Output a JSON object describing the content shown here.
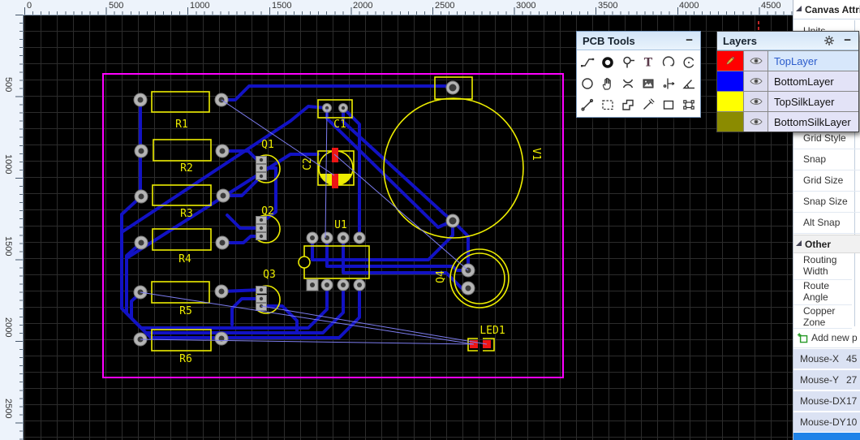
{
  "canvas": {
    "rulers": {
      "top": [
        "0",
        "500",
        "1000",
        "1500",
        "2000",
        "2500",
        "3000",
        "3500",
        "4000",
        "4500"
      ],
      "left": [
        "500",
        "1000",
        "1500",
        "2000",
        "2500"
      ]
    }
  },
  "pcb_tools": {
    "title": "PCB Tools",
    "minimize": "−",
    "tools": [
      "track",
      "pad",
      "via",
      "text",
      "arc",
      "arc-center",
      "circle",
      "drag",
      "hole",
      "image",
      "dimension",
      "angle",
      "measure",
      "select",
      "copper-area",
      "test-point",
      "rect",
      "group"
    ]
  },
  "layers": {
    "title": "Layers",
    "minimize": "−",
    "items": [
      {
        "label": "TopLayer",
        "color": "#ff0000",
        "active": true
      },
      {
        "label": "BottomLayer",
        "color": "#0000ff",
        "active": false
      },
      {
        "label": "TopSilkLayer",
        "color": "#ffff00",
        "active": false
      },
      {
        "label": "BottomSilkLayer",
        "color": "#8b8b00",
        "active": false
      }
    ]
  },
  "sidebar": {
    "title": "Canvas Attrib",
    "rows": [
      "Units",
      "Grid Style",
      "Snap",
      "Grid Size",
      "Snap Size",
      "Alt Snap"
    ],
    "other": {
      "title": "Other",
      "rows": [
        "Routing Width",
        "Route Angle",
        "Copper Zone"
      ]
    },
    "add_new": "Add new p",
    "mouse": [
      {
        "label": "Mouse-X",
        "value": "45"
      },
      {
        "label": "Mouse-Y",
        "value": "27"
      },
      {
        "label": "Mouse-DX",
        "value": "17"
      },
      {
        "label": "Mouse-DY",
        "value": "10"
      }
    ]
  },
  "board": {
    "outline_color": "#ff00ff",
    "trace_color": "#1212c4",
    "silk_color": "#eded00",
    "ratsnest_color": "#7d7df0",
    "pad_color": "#b4b4b4",
    "smd_pad_color": "#ee1515",
    "labels": {
      "R1": "R1",
      "R2": "R2",
      "R3": "R3",
      "R4": "R4",
      "R5": "R5",
      "R6": "R6",
      "Q1": "Q1",
      "Q2": "Q2",
      "Q3": "Q3",
      "Q4": "Q4",
      "C1": "C1",
      "C2": "C2",
      "U1": "U1",
      "V1": "V1",
      "LED1": "LED1"
    }
  }
}
